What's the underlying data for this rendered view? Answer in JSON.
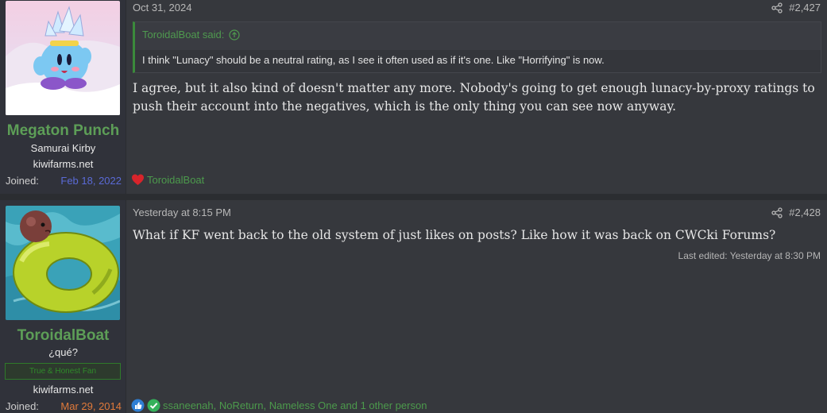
{
  "posts": [
    {
      "user": {
        "name": "Megaton Punch",
        "title": "Samurai Kirby",
        "site": "kiwifarms.net",
        "joined_label": "Joined:",
        "joined_date": "Feb 18, 2022"
      },
      "date": "Oct 31, 2024",
      "number": "#2,427",
      "quote": {
        "author": "ToroidalBoat said:",
        "text": "I think \"Lunacy\" should be a neutral rating, as I see it often used as if it's one. Like \"Horrifying\" is now."
      },
      "body": "I agree, but it also kind of doesn't matter any more. Nobody's going to get enough lunacy-by-proxy ratings to push their account into the negatives, which is the only thing you can see now anyway.",
      "reactions": {
        "icons": [
          "heart-icon"
        ],
        "text": "ToroidalBoat"
      }
    },
    {
      "user": {
        "name": "ToroidalBoat",
        "title": "¿qué?",
        "banner": "True & Honest Fan",
        "site": "kiwifarms.net",
        "joined_label": "Joined:",
        "joined_date": "Mar 29, 2014"
      },
      "date": "Yesterday at 8:15 PM",
      "number": "#2,428",
      "body": "What if KF went back to the old system of just likes on posts? Like how it was back on CWCki Forums?",
      "last_edited": "Last edited: Yesterday at 8:30 PM",
      "reactions": {
        "icons": [
          "thumbs-up-icon",
          "check-icon"
        ],
        "text": "ssaneenah, NoReturn, Nameless One and 1 other person"
      }
    }
  ],
  "colors": {
    "accent_green": "#5d9e57",
    "post_bg": "#36383d",
    "sidebar_bg": "#30323a"
  }
}
